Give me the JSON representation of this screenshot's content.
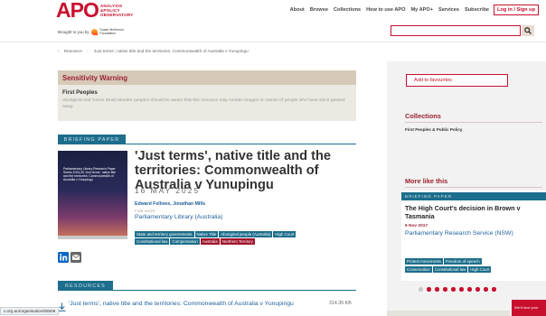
{
  "header": {
    "logo_big": "APO",
    "logo_small_1": "ANALYSIS",
    "logo_small_2": "&POLICY",
    "logo_small_3": "OBSERVATORY",
    "nav": [
      "About",
      "Browse",
      "Collections",
      "How to use APO",
      "My APO+",
      "Services",
      "Subscribe"
    ],
    "login_label": "Log in / Sign up",
    "brought_by": "Brought to you by",
    "sponsor_1": "Susan McKinnon",
    "sponsor_2": "Foundation",
    "search_placeholder": "",
    "search_icon": "search-icon",
    "accent": "#c8102e"
  },
  "breadcrumb": [
    "Resource",
    "'Just terms', native title and the territories: Commonwealth of Australia v Yunupingu"
  ],
  "sensitivity": {
    "heading": "Sensitivity Warning",
    "title": "First Peoples",
    "text": "Aboriginal and Torres Strait Islander peoples should be aware that this resource may contain images or names of people who have since passed away."
  },
  "resource": {
    "type_label": "BRIEFING PAPER",
    "cover_text": "Parliamentary Library Research Paper Series 2024-25 'Just terms', native title and the territories: Commonwealth of Australia v Yunupingu",
    "title": "'Just terms', native title and the territories: Commonwealth of Australia v Yunupingu",
    "date": "16 MAY 2025",
    "authors": "Edward Fellows, Jonathan Mills",
    "publisher_label": "PUBLISHER",
    "publisher": "Parliamentary Library (Australia)",
    "tags_row1": [
      "State and territory governments",
      "Native Title",
      "Aboriginal people (Australia)",
      "High Court"
    ],
    "tags_row2": [
      {
        "label": "Constitutional law",
        "color": "teal"
      },
      {
        "label": "Compensation",
        "color": "teal"
      },
      {
        "label": "Australia",
        "color": "red"
      },
      {
        "label": "Northern Territory",
        "color": "red"
      }
    ],
    "share_icons": [
      "linkedin-icon",
      "email-icon"
    ],
    "resources_label": "RESOURCES",
    "file_title": "'Just terms', native title and the territories: Commonwealth of Australia v Yunupingu",
    "file_size": "314.35 KB"
  },
  "status_url": "o.org.au/organisation/65509",
  "sidebar": {
    "favourites": "Add to favourites",
    "collections_heading": "Collections",
    "collections_item": "First Peoples & Public Policy",
    "more_heading": "More like this",
    "card": {
      "type_label": "BRIEFING PAPER",
      "title": "The High Court's decision in Brown v Tasmania",
      "date": "6 Nov 2017",
      "publisher": "Parliamentary Research Service (NSW)",
      "tags_row1": [
        "Protest movements",
        "Freedom of speech"
      ],
      "tags_row2": [
        "Conservation",
        "Constitutional law",
        "High Court"
      ]
    },
    "carousel_active_dot": 2,
    "carousel_total_dots": 10
  },
  "feedback": "We'd love your"
}
